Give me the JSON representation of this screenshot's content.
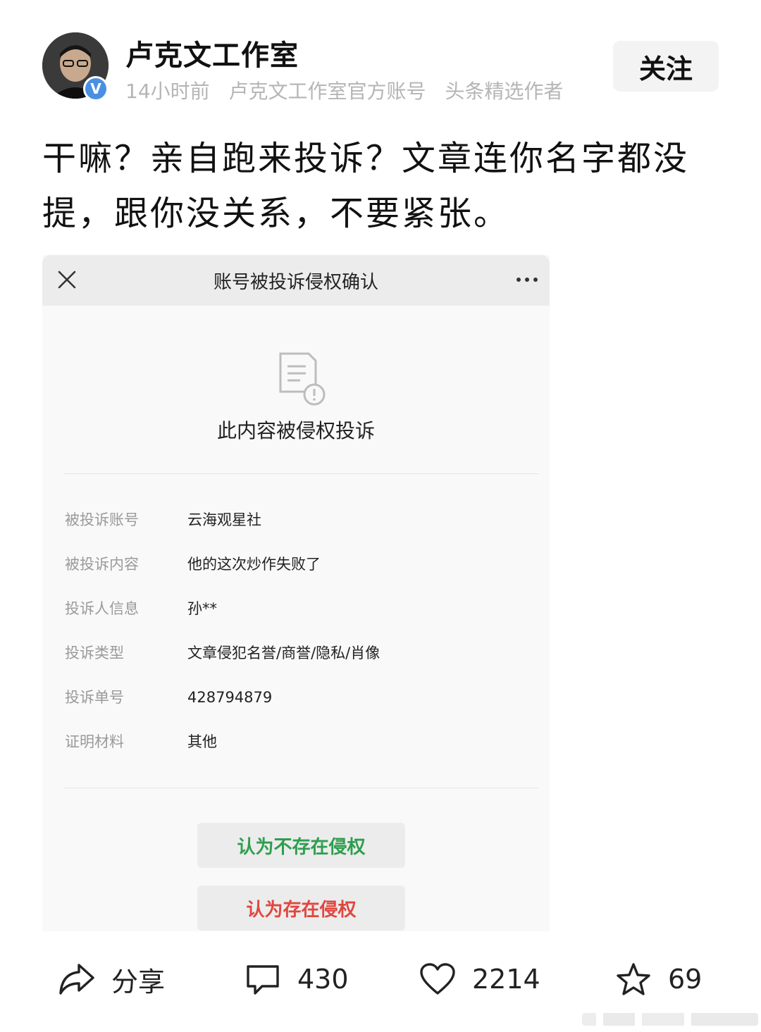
{
  "author": {
    "name": "卢克文工作室",
    "badge": "V",
    "time_ago": "14小时前",
    "descriptor": "卢克文工作室官方账号",
    "tag": "头条精选作者",
    "follow_label": "关注"
  },
  "post": {
    "line1": "干嘛？亲自跑来投诉？文章连你名字都没",
    "line2": "提，跟你没关系，不要紧张。"
  },
  "screenshot": {
    "title": "账号被投诉侵权确认",
    "heading": "此内容被侵权投诉",
    "rows": [
      {
        "label": "被投诉账号",
        "value": "云海观星社"
      },
      {
        "label": "被投诉内容",
        "value": "他的这次炒作失败了"
      },
      {
        "label": "投诉人信息",
        "value": "孙**"
      },
      {
        "label": "投诉类型",
        "value": "文章侵犯名誉/商誉/隐私/肖像"
      },
      {
        "label": "投诉单号",
        "value": "428794879"
      },
      {
        "label": "证明材料",
        "value": "其他"
      }
    ],
    "btn_no_infringe": "认为不存在侵权",
    "btn_infringe": "认为存在侵权",
    "colors": {
      "green": "#2e9e4f",
      "red": "#e0463f"
    }
  },
  "actions": {
    "share_label": "分享",
    "comment_count": "430",
    "like_count": "2214",
    "favorite_count": "69"
  },
  "icons": [
    "close-icon",
    "more-icon",
    "document-warning-icon",
    "share-icon",
    "comment-icon",
    "heart-icon",
    "star-icon"
  ]
}
